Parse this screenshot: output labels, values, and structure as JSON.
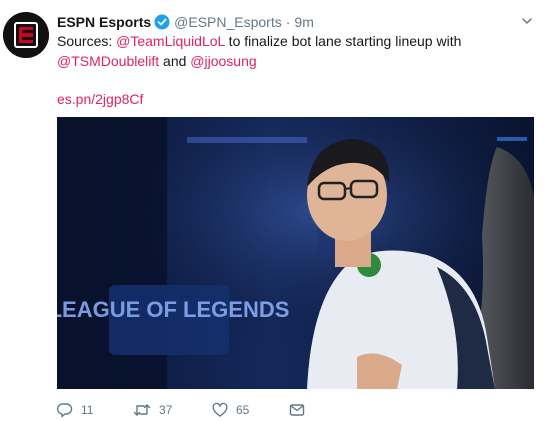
{
  "tweet": {
    "author_name": "ESPN Esports",
    "handle": "@ESPN_Esports",
    "separator": "·",
    "timestamp": "9m",
    "text_part1": "Sources: ",
    "mention1": "@TeamLiquidLoL",
    "text_part2": " to finalize bot lane starting lineup with",
    "mention2": "@TSMDoublelift",
    "text_part3": " and ",
    "mention3": "@jjoosung",
    "link": "es.pn/2jgp8Cf",
    "media_signage": "LEAGUE OF LEGENDS"
  },
  "actions": {
    "reply_count": "11",
    "retweet_count": "37",
    "like_count": "65"
  },
  "colors": {
    "link": "#e0245e",
    "muted": "#657786",
    "text": "#14171a",
    "verified": "#1da1f2"
  },
  "icons": [
    "espn-logo-icon",
    "verified-badge-icon",
    "chevron-down-icon",
    "reply-icon",
    "retweet-icon",
    "heart-icon",
    "direct-message-icon"
  ]
}
